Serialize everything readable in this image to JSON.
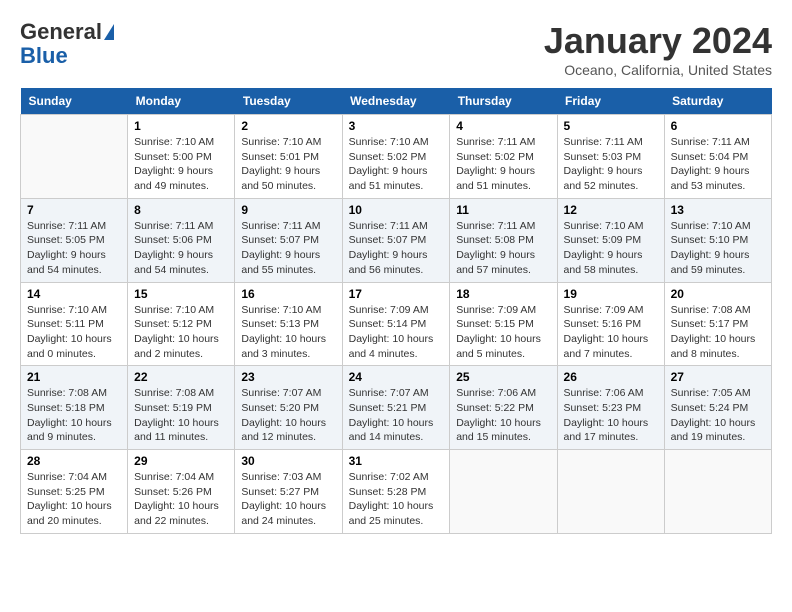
{
  "logo": {
    "general": "General",
    "blue": "Blue"
  },
  "header": {
    "month": "January 2024",
    "location": "Oceano, California, United States"
  },
  "weekdays": [
    "Sunday",
    "Monday",
    "Tuesday",
    "Wednesday",
    "Thursday",
    "Friday",
    "Saturday"
  ],
  "weeks": [
    [
      {
        "day": null
      },
      {
        "day": "1",
        "sunrise": "7:10 AM",
        "sunset": "5:00 PM",
        "daylight": "9 hours and 49 minutes."
      },
      {
        "day": "2",
        "sunrise": "7:10 AM",
        "sunset": "5:01 PM",
        "daylight": "9 hours and 50 minutes."
      },
      {
        "day": "3",
        "sunrise": "7:10 AM",
        "sunset": "5:02 PM",
        "daylight": "9 hours and 51 minutes."
      },
      {
        "day": "4",
        "sunrise": "7:11 AM",
        "sunset": "5:02 PM",
        "daylight": "9 hours and 51 minutes."
      },
      {
        "day": "5",
        "sunrise": "7:11 AM",
        "sunset": "5:03 PM",
        "daylight": "9 hours and 52 minutes."
      },
      {
        "day": "6",
        "sunrise": "7:11 AM",
        "sunset": "5:04 PM",
        "daylight": "9 hours and 53 minutes."
      }
    ],
    [
      {
        "day": "7",
        "sunrise": "7:11 AM",
        "sunset": "5:05 PM",
        "daylight": "9 hours and 54 minutes."
      },
      {
        "day": "8",
        "sunrise": "7:11 AM",
        "sunset": "5:06 PM",
        "daylight": "9 hours and 54 minutes."
      },
      {
        "day": "9",
        "sunrise": "7:11 AM",
        "sunset": "5:07 PM",
        "daylight": "9 hours and 55 minutes."
      },
      {
        "day": "10",
        "sunrise": "7:11 AM",
        "sunset": "5:07 PM",
        "daylight": "9 hours and 56 minutes."
      },
      {
        "day": "11",
        "sunrise": "7:11 AM",
        "sunset": "5:08 PM",
        "daylight": "9 hours and 57 minutes."
      },
      {
        "day": "12",
        "sunrise": "7:10 AM",
        "sunset": "5:09 PM",
        "daylight": "9 hours and 58 minutes."
      },
      {
        "day": "13",
        "sunrise": "7:10 AM",
        "sunset": "5:10 PM",
        "daylight": "9 hours and 59 minutes."
      }
    ],
    [
      {
        "day": "14",
        "sunrise": "7:10 AM",
        "sunset": "5:11 PM",
        "daylight": "10 hours and 0 minutes."
      },
      {
        "day": "15",
        "sunrise": "7:10 AM",
        "sunset": "5:12 PM",
        "daylight": "10 hours and 2 minutes."
      },
      {
        "day": "16",
        "sunrise": "7:10 AM",
        "sunset": "5:13 PM",
        "daylight": "10 hours and 3 minutes."
      },
      {
        "day": "17",
        "sunrise": "7:09 AM",
        "sunset": "5:14 PM",
        "daylight": "10 hours and 4 minutes."
      },
      {
        "day": "18",
        "sunrise": "7:09 AM",
        "sunset": "5:15 PM",
        "daylight": "10 hours and 5 minutes."
      },
      {
        "day": "19",
        "sunrise": "7:09 AM",
        "sunset": "5:16 PM",
        "daylight": "10 hours and 7 minutes."
      },
      {
        "day": "20",
        "sunrise": "7:08 AM",
        "sunset": "5:17 PM",
        "daylight": "10 hours and 8 minutes."
      }
    ],
    [
      {
        "day": "21",
        "sunrise": "7:08 AM",
        "sunset": "5:18 PM",
        "daylight": "10 hours and 9 minutes."
      },
      {
        "day": "22",
        "sunrise": "7:08 AM",
        "sunset": "5:19 PM",
        "daylight": "10 hours and 11 minutes."
      },
      {
        "day": "23",
        "sunrise": "7:07 AM",
        "sunset": "5:20 PM",
        "daylight": "10 hours and 12 minutes."
      },
      {
        "day": "24",
        "sunrise": "7:07 AM",
        "sunset": "5:21 PM",
        "daylight": "10 hours and 14 minutes."
      },
      {
        "day": "25",
        "sunrise": "7:06 AM",
        "sunset": "5:22 PM",
        "daylight": "10 hours and 15 minutes."
      },
      {
        "day": "26",
        "sunrise": "7:06 AM",
        "sunset": "5:23 PM",
        "daylight": "10 hours and 17 minutes."
      },
      {
        "day": "27",
        "sunrise": "7:05 AM",
        "sunset": "5:24 PM",
        "daylight": "10 hours and 19 minutes."
      }
    ],
    [
      {
        "day": "28",
        "sunrise": "7:04 AM",
        "sunset": "5:25 PM",
        "daylight": "10 hours and 20 minutes."
      },
      {
        "day": "29",
        "sunrise": "7:04 AM",
        "sunset": "5:26 PM",
        "daylight": "10 hours and 22 minutes."
      },
      {
        "day": "30",
        "sunrise": "7:03 AM",
        "sunset": "5:27 PM",
        "daylight": "10 hours and 24 minutes."
      },
      {
        "day": "31",
        "sunrise": "7:02 AM",
        "sunset": "5:28 PM",
        "daylight": "10 hours and 25 minutes."
      },
      {
        "day": null
      },
      {
        "day": null
      },
      {
        "day": null
      }
    ]
  ],
  "labels": {
    "sunrise": "Sunrise:",
    "sunset": "Sunset:",
    "daylight": "Daylight:"
  }
}
